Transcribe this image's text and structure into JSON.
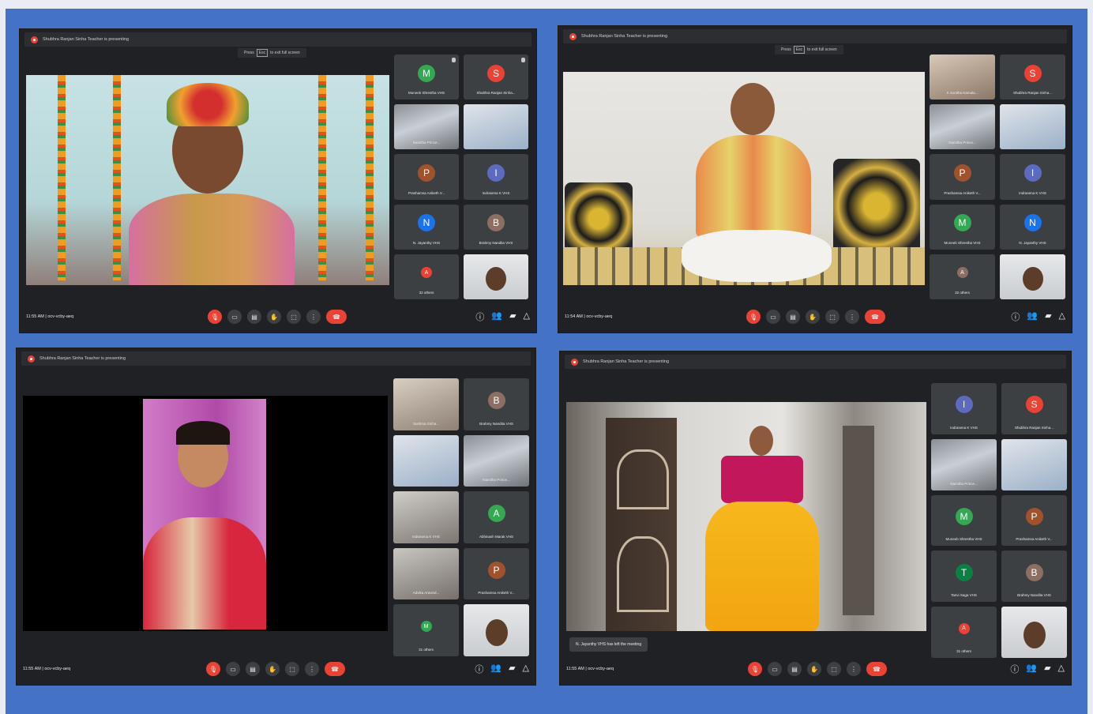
{
  "colors": {
    "slide_bg": "#4472c4",
    "meet_bg": "#202124",
    "tile_bg": "#3c4043",
    "red": "#ea4335"
  },
  "panels": [
    {
      "presenting": "Shubhra Ranjan Sinha Teacher is presenting",
      "esc_hint": {
        "pre": "Press",
        "key": "Esc",
        "post": "to exit full screen"
      },
      "meeting_info": "11:55 AM  |  ocv-vcby-aeq",
      "tiles": [
        {
          "letter": "M",
          "color": "#34a853",
          "name": "Muneeb Shrestha VHS"
        },
        {
          "letter": "S",
          "color": "#ea4335",
          "name": "Shubhra Ranjan Sinha..."
        },
        {
          "letter": "",
          "color": "",
          "name": "Namitha Prince..."
        },
        {
          "letter": "",
          "color": "",
          "name": ""
        },
        {
          "letter": "P",
          "color": "#a0522d",
          "name": "Prashamsa Aniketh V..."
        },
        {
          "letter": "I",
          "color": "#5c6bc0",
          "name": "Indrasena K VHS"
        },
        {
          "letter": "N",
          "color": "#1a73e8",
          "name": "N. Jayanthy VHS"
        },
        {
          "letter": "B",
          "color": "#8d6e63",
          "name": "Brahmy Nandita VHS"
        },
        {
          "letter": "A",
          "color": "#ea4335",
          "name": "32 others"
        },
        {
          "letter": "",
          "color": "",
          "name": ""
        }
      ]
    },
    {
      "presenting": "Shubhra Ranjan Sinha Teacher is presenting",
      "esc_hint": {
        "pre": "Press",
        "key": "Esc",
        "post": "to exit full screen"
      },
      "meeting_info": "11:54 AM  |  ocv-vcby-aeq",
      "tiles": [
        {
          "letter": "",
          "color": "",
          "name": "K Sonitha Kamala..."
        },
        {
          "letter": "S",
          "color": "#ea4335",
          "name": "Shubhra Ranjan Sinha..."
        },
        {
          "letter": "",
          "color": "",
          "name": "Namitha Prince..."
        },
        {
          "letter": "",
          "color": "",
          "name": ""
        },
        {
          "letter": "P",
          "color": "#a0522d",
          "name": "Prashamsa Aniketh V..."
        },
        {
          "letter": "I",
          "color": "#5c6bc0",
          "name": "Indrasena K VHS"
        },
        {
          "letter": "M",
          "color": "#34a853",
          "name": "Muneeb Shrestha VHS"
        },
        {
          "letter": "N",
          "color": "#1a73e8",
          "name": "N. Jayanthy VHS"
        },
        {
          "letter": "A",
          "color": "#8d6e63",
          "name": "32 others"
        },
        {
          "letter": "",
          "color": "",
          "name": ""
        }
      ]
    },
    {
      "presenting": "Shubhra Ranjan Sinha Teacher is presenting",
      "meeting_info": "11:55 AM  |  ocv-vcby-aeq",
      "tiles": [
        {
          "letter": "",
          "color": "",
          "name": "Sushma Sinha..."
        },
        {
          "letter": "B",
          "color": "#8d6e63",
          "name": "Brahmy Nandita VHS"
        },
        {
          "letter": "",
          "color": "",
          "name": ""
        },
        {
          "letter": "",
          "color": "",
          "name": "Namitha Prince..."
        },
        {
          "letter": "",
          "color": "",
          "name": "Indrasena K VHS"
        },
        {
          "letter": "A",
          "color": "#34a853",
          "name": "Abhinash Marak VHS"
        },
        {
          "letter": "",
          "color": "",
          "name": "Advika Aravind..."
        },
        {
          "letter": "P",
          "color": "#a0522d",
          "name": "Prashamsa Aniketh V..."
        },
        {
          "letter": "M",
          "color": "#34a853",
          "name": "31 others"
        },
        {
          "letter": "",
          "color": "",
          "name": ""
        }
      ]
    },
    {
      "presenting": "Shubhra Ranjan Sinha Teacher is presenting",
      "meeting_info": "11:55 AM  |  ocv-vcby-aeq",
      "toast": "N. Jayanthy VHS has left the meeting",
      "tiles": [
        {
          "letter": "I",
          "color": "#5c6bc0",
          "name": "Indrasena K VHS"
        },
        {
          "letter": "S",
          "color": "#ea4335",
          "name": "Shubhra Ranjan Sinha..."
        },
        {
          "letter": "",
          "color": "",
          "name": "Namitha Prince..."
        },
        {
          "letter": "",
          "color": "",
          "name": ""
        },
        {
          "letter": "M",
          "color": "#34a853",
          "name": "Muneeb Shrestha VHS"
        },
        {
          "letter": "P",
          "color": "#a0522d",
          "name": "Prashamsa Aniketh V..."
        },
        {
          "letter": "T",
          "color": "#0b8043",
          "name": "Tanvi Saga VHS"
        },
        {
          "letter": "B",
          "color": "#8d6e63",
          "name": "Brahmy Nandita VHS"
        },
        {
          "letter": "A",
          "color": "#ea4335",
          "name": "31 others"
        },
        {
          "letter": "",
          "color": "",
          "name": ""
        }
      ]
    }
  ]
}
